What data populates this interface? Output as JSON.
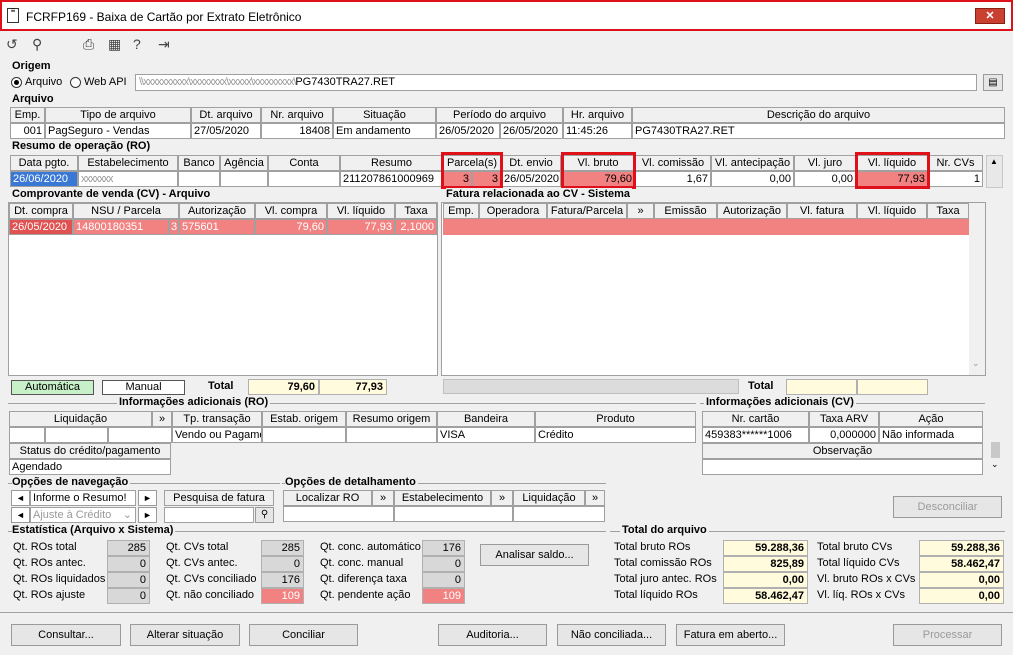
{
  "window": {
    "title": "FCRFP169 - Baixa de Cartão por Extrato Eletrônico",
    "close": "✕"
  },
  "toolbar": {
    "icons": [
      "undo-icon",
      "search-icon",
      "print-icon",
      "calendar-icon",
      "help-icon",
      "exit-icon"
    ]
  },
  "origem": {
    "section": "Origem",
    "opt_arquivo": "Arquivo",
    "opt_webapi": "Web API",
    "file_blur": "\\\\xxxxxxxxxx\\xxxxxxxx\\xxxxx\\xxxxxxxxx\\",
    "file_name": "PG7430TRA27.RET"
  },
  "arquivo": {
    "section": "Arquivo",
    "headers": [
      "Emp.",
      "Tipo de arquivo",
      "Dt. arquivo",
      "Nr. arquivo",
      "Situação",
      "Período do arquivo",
      "Hr. arquivo",
      "Descrição do arquivo"
    ],
    "row": {
      "emp": "001",
      "tipo": "PagSeguro - Vendas",
      "dt": "27/05/2020",
      "nr": "18408",
      "situacao": "Em andamento",
      "periodo_ini": "26/05/2020",
      "periodo_fim": "26/05/2020",
      "hr": "11:45:26",
      "descricao": "PG7430TRA27.RET"
    }
  },
  "resumo": {
    "section": "Resumo de operação (RO)",
    "headers": [
      "Data pgto.",
      "Estabelecimento",
      "Banco",
      "Agência",
      "Conta",
      "Resumo",
      "Parcela(s)",
      "Dt. envio",
      "Vl. bruto",
      "Vl. comissão",
      "Vl. antecipação",
      "Vl. juro",
      "Vl. líquido",
      "Nr. CVs"
    ],
    "row": {
      "data": "26/06/2020",
      "estab": "xxxxxxx",
      "banco": "",
      "agencia": "",
      "conta": "",
      "resumo": "211207861000969",
      "parc1": "3",
      "parc2": "3",
      "dtenvio": "26/05/2020",
      "bruto": "79,60",
      "comissao": "1,67",
      "antecip": "0,00",
      "juro": "0,00",
      "liquido": "77,93",
      "nrcvs": "1"
    }
  },
  "cv": {
    "section": "Comprovante de venda (CV) - Arquivo",
    "headers": [
      "Dt. compra",
      "NSU / Parcela",
      "Autorização",
      "Vl. compra",
      "Vl. líquido",
      "Taxa"
    ],
    "row": {
      "dt": "26/05/2020",
      "nsu": "14800180351",
      "parc": "3",
      "aut": "575601",
      "compra": "79,60",
      "liquido": "77,93",
      "taxa": "2,1000"
    },
    "legend_auto": "Automática",
    "legend_manual": "Manual",
    "total_label": "Total",
    "total_compra": "79,60",
    "total_liquido": "77,93"
  },
  "fatura": {
    "section": "Fatura relacionada ao CV - Sistema",
    "headers": [
      "Emp.",
      "Operadora",
      "Fatura/Parcela",
      "»",
      "Emissão",
      "Autorização",
      "Vl. fatura",
      "Vl. líquido",
      "Taxa"
    ],
    "total_label": "Total"
  },
  "info_ro": {
    "section": "Informações adicionais (RO)",
    "headers": [
      "Liquidação",
      "»",
      "Tp. transação",
      "Estab. origem",
      "Resumo origem",
      "Bandeira",
      "Produto"
    ],
    "row": {
      "tp": "Vendo ou Pagame",
      "bandeira": "VISA",
      "produto": "Crédito"
    },
    "status_label": "Status do crédito/pagamento",
    "status_value": "Agendado"
  },
  "info_cv": {
    "section": "Informações adicionais (CV)",
    "headers": [
      "Nr. cartão",
      "Taxa ARV",
      "Ação"
    ],
    "row": {
      "cartao": "459383******1006",
      "taxa": "0,000000",
      "acao": "Não informada"
    },
    "obs_label": "Observação"
  },
  "nav": {
    "section": "Opções de navegação",
    "combo1": "Informe o Resumo!",
    "combo2": "Ajuste à Crédito",
    "pesquisa": "Pesquisa de fatura"
  },
  "detalhe": {
    "section": "Opções de detalhamento",
    "cols": [
      "Localizar RO",
      "»",
      "Estabelecimento",
      "»",
      "Liquidação",
      "»"
    ]
  },
  "desconciliar": "Desconciliar",
  "estat": {
    "section": "Estatística (Arquivo x Sistema)",
    "c1": [
      {
        "label": "Qt. ROs total",
        "value": "285"
      },
      {
        "label": "Qt. ROs antec.",
        "value": "0"
      },
      {
        "label": "Qt. ROs liquidados",
        "value": "0"
      },
      {
        "label": "Qt. ROs ajuste",
        "value": "0"
      }
    ],
    "c2": [
      {
        "label": "Qt. CVs total",
        "value": "285"
      },
      {
        "label": "Qt. CVs antec.",
        "value": "0"
      },
      {
        "label": "Qt. CVs conciliado",
        "value": "176"
      },
      {
        "label": "Qt. não conciliado",
        "value": "109"
      }
    ],
    "c3": [
      {
        "label": "Qt. conc. automático",
        "value": "176"
      },
      {
        "label": "Qt. conc. manual",
        "value": "0"
      },
      {
        "label": "Qt. diferença taxa",
        "value": "0"
      },
      {
        "label": "Qt. pendente ação",
        "value": "109"
      }
    ],
    "analisar": "Analisar saldo..."
  },
  "total_arq": {
    "section": "Total do arquivo",
    "c1": [
      {
        "label": "Total bruto ROs",
        "value": "59.288,36"
      },
      {
        "label": "Total comissão ROs",
        "value": "825,89"
      },
      {
        "label": "Total juro antec. ROs",
        "value": "0,00"
      },
      {
        "label": "Total líquido ROs",
        "value": "58.462,47"
      }
    ],
    "c2": [
      {
        "label": "Total bruto CVs",
        "value": "59.288,36"
      },
      {
        "label": "Total líquido CVs",
        "value": "58.462,47"
      },
      {
        "label": "Vl. bruto ROs x CVs",
        "value": "0,00"
      },
      {
        "label": "Vl. líq. ROs x CVs",
        "value": "0,00"
      }
    ]
  },
  "buttons": {
    "consultar": "Consultar...",
    "alterar": "Alterar situação",
    "conciliar": "Conciliar",
    "auditoria": "Auditoria...",
    "nao_conc": "Não conciliada...",
    "fatura": "Fatura em aberto...",
    "processar": "Processar"
  },
  "colors": {
    "highlight": "#e0101a",
    "row_selected": "#f28282",
    "accent_legend": "#c8f0c8"
  }
}
